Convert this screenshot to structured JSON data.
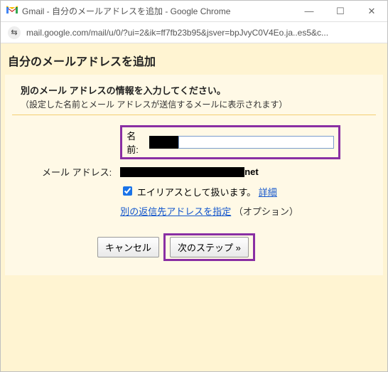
{
  "window": {
    "title": "Gmail - 自分のメールアドレスを追加 - Google Chrome",
    "minimize_glyph": "—",
    "maximize_glyph": "☐",
    "close_glyph": "✕"
  },
  "addressbar": {
    "page_icon_glyph": "⇆",
    "url": "mail.google.com/mail/u/0/?ui=2&ik=ff7fb23b95&jsver=bpJvyC0V4Eo.ja..es5&c..."
  },
  "header": {
    "title": "自分のメールアドレスを追加"
  },
  "panel": {
    "subtitle": "別のメール アドレスの情報を入力してください。",
    "subnote": "（設定した名前とメール アドレスが送信するメールに表示されます）"
  },
  "form": {
    "name_label": "名前:",
    "name_value": "",
    "email_label": "メール アドレス:",
    "email_suffix": "net",
    "alias_checked": true,
    "alias_text": "エイリアスとして扱います。",
    "alias_detail_link": "詳細",
    "reply_link": "別の返信先アドレスを指定",
    "reply_option": "（オプション）"
  },
  "buttons": {
    "cancel": "キャンセル",
    "next": "次のステップ »"
  }
}
